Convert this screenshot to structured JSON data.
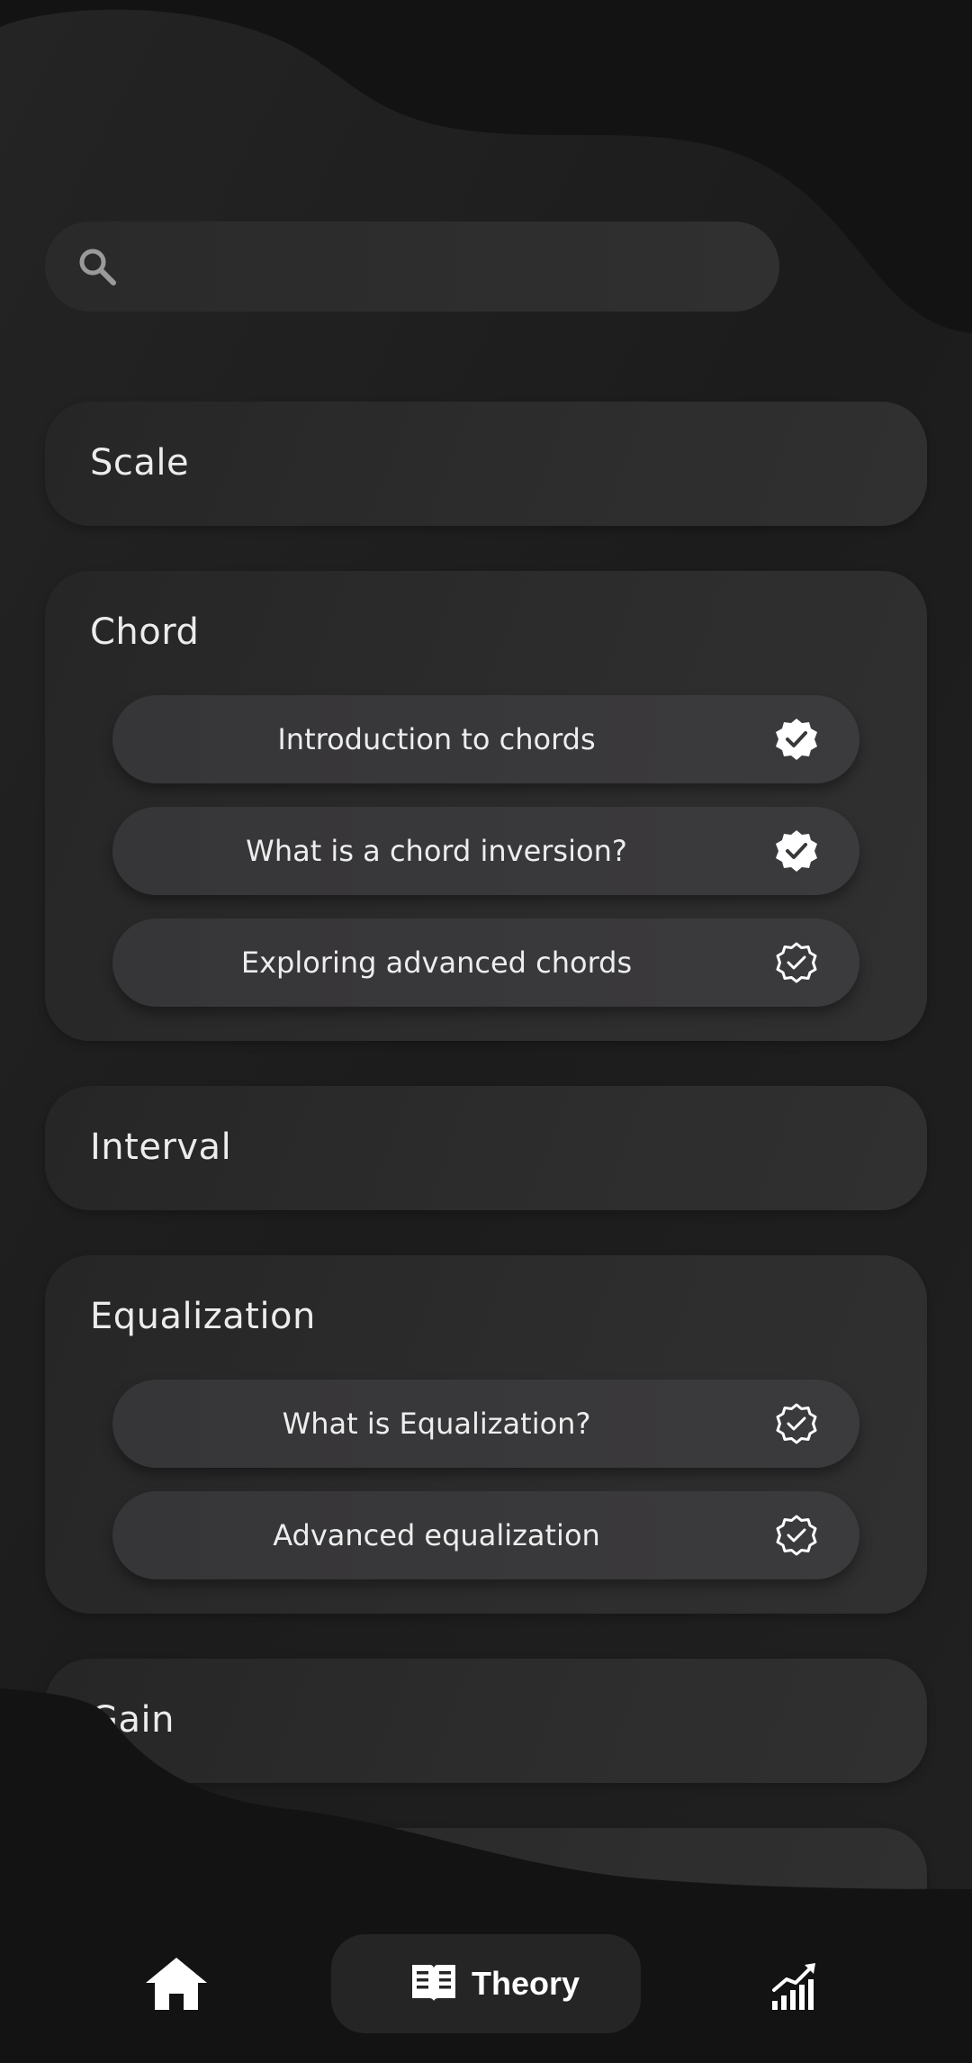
{
  "search": {
    "placeholder": "",
    "value": ""
  },
  "categories": [
    {
      "title": "Scale",
      "lessons": []
    },
    {
      "title": "Chord",
      "lessons": [
        {
          "label": "Introduction to chords",
          "completed": true
        },
        {
          "label": "What is a chord inversion?",
          "completed": true
        },
        {
          "label": "Exploring advanced chords",
          "completed": false
        }
      ]
    },
    {
      "title": "Interval",
      "lessons": []
    },
    {
      "title": "Equalization",
      "lessons": [
        {
          "label": "What is Equalization?",
          "completed": false
        },
        {
          "label": "Advanced equalization",
          "completed": false
        }
      ]
    },
    {
      "title": "Gain",
      "lessons": []
    }
  ],
  "bottom_nav": {
    "items": [
      {
        "icon": "home-icon",
        "label": ""
      },
      {
        "icon": "book-icon",
        "label": "Theory",
        "active": true
      },
      {
        "icon": "stats-icon",
        "label": ""
      }
    ]
  },
  "colors": {
    "background": "#131313",
    "card": "#2b2b2b",
    "lesson": "#38373a",
    "text": "#ececec"
  }
}
